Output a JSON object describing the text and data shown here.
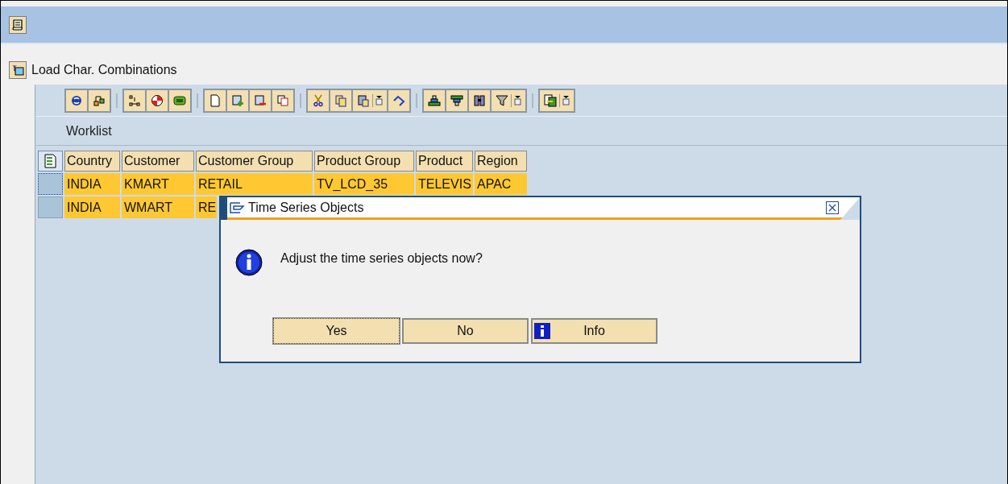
{
  "screen": {
    "title": "Load Char. Combinations"
  },
  "worklist": {
    "title": "Worklist"
  },
  "table": {
    "columns": [
      "Country",
      "Customer",
      "Customer Group",
      "Product Group",
      "Product",
      "Region"
    ],
    "rows": [
      {
        "selected": false,
        "cells": [
          "INDIA",
          "KMART",
          "RETAIL",
          "TV_LCD_35",
          "TELEVIS",
          "APAC"
        ]
      },
      {
        "selected": false,
        "cells": [
          "INDIA",
          "WMART",
          "RE"
        ]
      }
    ]
  },
  "dialog": {
    "title": "Time Series Objects",
    "message": "Adjust the time series objects now?",
    "buttons": [
      {
        "label": "Yes",
        "kind": "plain",
        "focused": true
      },
      {
        "label": "No",
        "kind": "plain",
        "focused": false
      },
      {
        "label": "Info",
        "kind": "info",
        "focused": false
      }
    ]
  }
}
